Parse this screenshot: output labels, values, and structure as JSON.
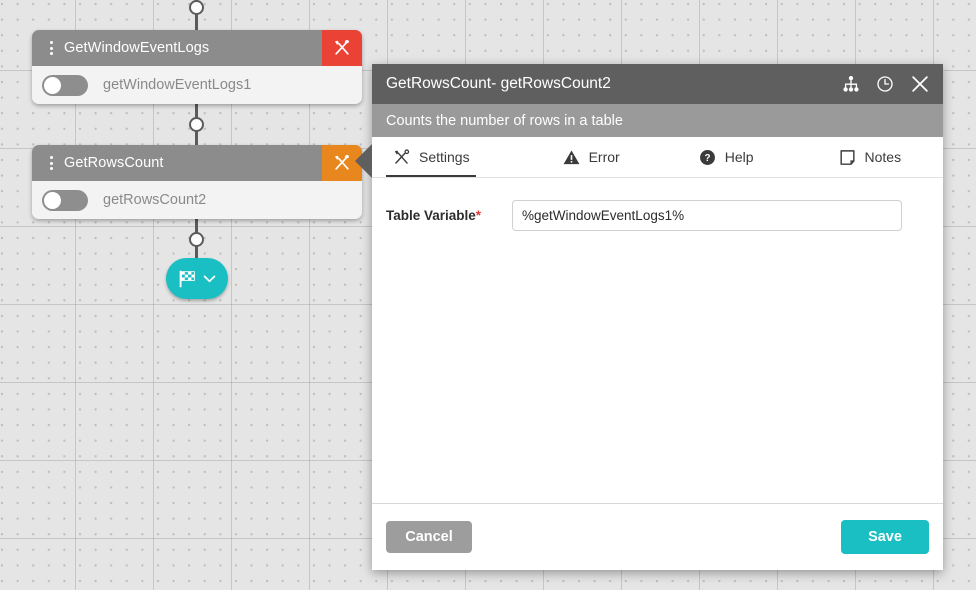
{
  "canvas": {
    "nodes": [
      {
        "id": "node-get-window-event-logs",
        "title": "GetWindowEventLogs",
        "instance": "getWindowEventLogs1",
        "tool_icon": "tools-icon",
        "tool_color": "#ea4335",
        "menu_icon": "kebab-menu-icon",
        "toggle_state": "off"
      },
      {
        "id": "node-get-rows-count",
        "title": "GetRowsCount",
        "instance": "getRowsCount2",
        "tool_icon": "tools-icon",
        "tool_color": "#e8871e",
        "menu_icon": "kebab-menu-icon",
        "toggle_state": "off"
      }
    ],
    "end_node": {
      "icon": "checkered-flag-icon",
      "chevron": "chevron-down-icon",
      "color": "#1abfc4"
    }
  },
  "dialog": {
    "title": "GetRowsCount-  getRowsCount2",
    "subtitle": "Counts the number of rows in a table",
    "titlebar_icons": [
      {
        "name": "hierarchy-icon"
      },
      {
        "name": "clock-icon"
      },
      {
        "name": "close-icon"
      }
    ],
    "tabs": [
      {
        "label": "Settings",
        "icon": "tools-icon",
        "active": true
      },
      {
        "label": "Error",
        "icon": "warning-triangle-icon",
        "active": false
      },
      {
        "label": "Help",
        "icon": "question-circle-icon",
        "active": false
      },
      {
        "label": "Notes",
        "icon": "note-page-icon",
        "active": false
      }
    ],
    "fields": [
      {
        "label": "Table Variable",
        "required_marker": "*",
        "value": "%getWindowEventLogs1%",
        "placeholder": ""
      }
    ],
    "footer": {
      "cancel_label": "Cancel",
      "save_label": "Save"
    }
  },
  "colors": {
    "accent_teal": "#1abfc4",
    "node_header": "#8c8c8c",
    "dialog_header": "#5f5f5f",
    "dialog_subheader": "#9a9a9a",
    "required_red": "#e03b3b",
    "tool_red": "#ea4335",
    "tool_orange": "#e8871e"
  }
}
